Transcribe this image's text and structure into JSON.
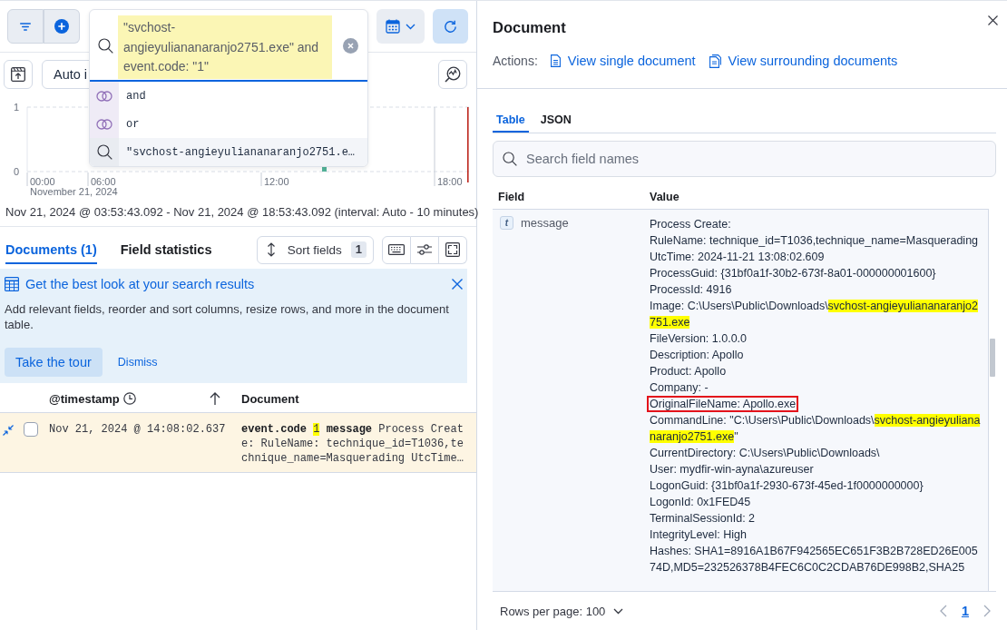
{
  "search_bar": {
    "query": {
      "text": "\"svchost-angieyuliananaranjo2751.exe\" and event.code: \"1\"",
      "highlighted": true
    },
    "suggestions": [
      {
        "kind": "conjunction",
        "text": "and",
        "selected": false
      },
      {
        "kind": "conjunction",
        "text": "or",
        "selected": false
      },
      {
        "kind": "value",
        "text": "\"svchost-angieyuliananaranjo2751.e…",
        "selected": true
      }
    ]
  },
  "interval_select": {
    "value": "Auto i"
  },
  "histogram": {
    "y_labels": [
      "1",
      "0"
    ],
    "x_labels": [
      "00:00",
      "06:00",
      "12:00",
      "18:00"
    ],
    "date_label": "November 21, 2024"
  },
  "time_range": "Nov 21, 2024 @ 03:53:43.092 - Nov 21, 2024 @ 18:53:43.092 (interval: Auto - 10 minutes)",
  "view_tabs": [
    {
      "label": "Documents (1)",
      "selected": true
    },
    {
      "label": "Field statistics",
      "selected": false
    }
  ],
  "sort_fields": {
    "label": "Sort fields",
    "count": "1"
  },
  "callout": {
    "title": "Get the best look at your search results",
    "body": "Add relevant fields, reorder and sort columns, resize rows, and more in the document table.",
    "primary_action": "Take the tour",
    "secondary_action": "Dismiss"
  },
  "grid": {
    "columns": [
      {
        "kind": "time",
        "label": "@timestamp",
        "sorted": true
      },
      {
        "kind": "document",
        "label": "Document",
        "sorted": false
      }
    ],
    "rows": [
      {
        "expanded": true,
        "checked": false,
        "timestamp": "Nov 21, 2024 @ 14:08:02.637",
        "document": [
          {
            "kind": "key",
            "text": "event.code"
          },
          {
            "kind": "value",
            "text": "1",
            "highlighted": true
          },
          {
            "kind": "key",
            "text": "message"
          },
          {
            "kind": "value",
            "text": "Process Create: RuleName: technique_id=T1036,technique_name=Masquerading UtcTime…",
            "highlighted": false
          }
        ]
      }
    ]
  },
  "flyout": {
    "title": "Document",
    "actions_label": "Actions:",
    "actions": [
      {
        "kind": "single",
        "label": "View single document"
      },
      {
        "kind": "surrounding",
        "label": "View surrounding documents"
      }
    ],
    "tabs": [
      {
        "label": "Table",
        "selected": true
      },
      {
        "label": "JSON",
        "selected": false
      }
    ],
    "search": {
      "placeholder": "Search field names"
    },
    "columns": [
      "Field",
      "Value"
    ],
    "fields": [
      {
        "token": "t",
        "name": "message",
        "lines": [
          {
            "parts": [
              {
                "text": "Process Create:",
                "highlighted": false
              }
            ],
            "outlined": false
          },
          {
            "parts": [
              {
                "text": "RuleName: technique_id=T1036,technique_name=Masquerading",
                "highlighted": false
              }
            ],
            "outlined": false
          },
          {
            "parts": [
              {
                "text": "UtcTime: 2024-11-21 13:08:02.609",
                "highlighted": false
              }
            ],
            "outlined": false
          },
          {
            "parts": [
              {
                "text": "ProcessGuid: {31bf0a1f-30b2-673f-8a01-000000001600}",
                "highlighted": false
              }
            ],
            "outlined": false
          },
          {
            "parts": [
              {
                "text": "ProcessId: 4916",
                "highlighted": false
              }
            ],
            "outlined": false
          },
          {
            "parts": [
              {
                "text": "Image: C:\\Users\\Public\\Downloads\\",
                "highlighted": false
              },
              {
                "text": "svchost-angieyuliananaranjo2751.exe",
                "highlighted": true
              }
            ],
            "outlined": false
          },
          {
            "parts": [
              {
                "text": "FileVersion: 1.0.0.0",
                "highlighted": false
              }
            ],
            "outlined": false
          },
          {
            "parts": [
              {
                "text": "Description: Apollo",
                "highlighted": false
              }
            ],
            "outlined": false
          },
          {
            "parts": [
              {
                "text": "Product: Apollo",
                "highlighted": false
              }
            ],
            "outlined": false
          },
          {
            "parts": [
              {
                "text": "Company: -",
                "highlighted": false
              }
            ],
            "outlined": false
          },
          {
            "parts": [
              {
                "text": "OriginalFileName: Apollo.exe",
                "highlighted": false
              }
            ],
            "outlined": true
          },
          {
            "parts": [
              {
                "text": "CommandLine: \"C:\\Users\\Public\\Downloads\\",
                "highlighted": false
              },
              {
                "text": "svchost-angieyuliananaranjo2751.exe",
                "highlighted": true
              },
              {
                "text": "\"",
                "highlighted": false
              }
            ],
            "outlined": false
          },
          {
            "parts": [
              {
                "text": "CurrentDirectory: C:\\Users\\Public\\Downloads\\",
                "highlighted": false
              }
            ],
            "outlined": false
          },
          {
            "parts": [
              {
                "text": "User: mydfir-win-ayna\\azureuser",
                "highlighted": false
              }
            ],
            "outlined": false
          },
          {
            "parts": [
              {
                "text": "LogonGuid: {31bf0a1f-2930-673f-45ed-1f0000000000}",
                "highlighted": false
              }
            ],
            "outlined": false
          },
          {
            "parts": [
              {
                "text": "LogonId: 0x1FED45",
                "highlighted": false
              }
            ],
            "outlined": false
          },
          {
            "parts": [
              {
                "text": "TerminalSessionId: 2",
                "highlighted": false
              }
            ],
            "outlined": false
          },
          {
            "parts": [
              {
                "text": "IntegrityLevel: High",
                "highlighted": false
              }
            ],
            "outlined": false
          },
          {
            "parts": [
              {
                "text": "Hashes: SHA1=8916A1B67F942565EC651F3B2B728ED26E00574D,MD5=232526378B4FEC6C0C2CDAB76DE998B2,SHA25",
                "highlighted": false
              }
            ],
            "outlined": false
          }
        ]
      }
    ],
    "footer": {
      "rows_per_page": "Rows per page: 100",
      "pages": [
        {
          "label": "1",
          "selected": true
        }
      ],
      "previous_disabled": true,
      "next_disabled": true
    }
  }
}
